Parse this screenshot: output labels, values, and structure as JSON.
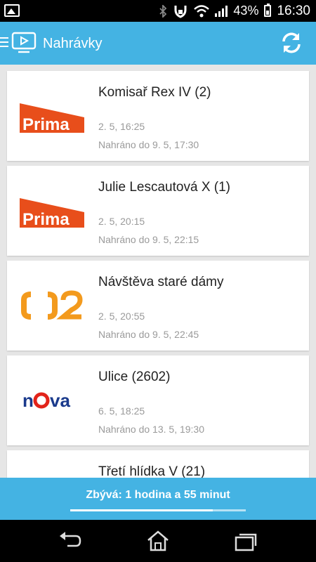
{
  "status_bar": {
    "notification_icon": "gallery-icon",
    "icons": [
      "bluetooth-icon",
      "lock-icon",
      "wifi-icon",
      "signal-icon"
    ],
    "battery_percent": "43%",
    "battery_level": 0.43,
    "time": "16:30"
  },
  "app_bar": {
    "title": "Nahrávky",
    "menu_icon": "hamburger-icon",
    "logo_icon": "tv-play-icon",
    "action_icon": "refresh-icon"
  },
  "recordings": [
    {
      "channel": "Prima",
      "title": "Komisař Rex IV (2)",
      "time": "2. 5, 16:25",
      "until": "Nahráno do 9. 5, 17:30"
    },
    {
      "channel": "Prima",
      "title": "Julie Lescautová X (1)",
      "time": "2. 5, 20:15",
      "until": "Nahráno do 9. 5, 22:15"
    },
    {
      "channel": "ČT2",
      "title": "Návštěva staré dámy",
      "time": "2. 5, 20:55",
      "until": "Nahráno do 9. 5, 22:45"
    },
    {
      "channel": "Nova",
      "title": "Ulice (2602)",
      "time": "6. 5, 18:25",
      "until": "Nahráno do 13. 5, 19:30"
    },
    {
      "channel": "",
      "title": "Třetí hlídka V (21)",
      "time": "",
      "until": ""
    }
  ],
  "remaining": {
    "text": "Zbývá: 1 hodina a 55 minut",
    "progress": 0.81
  },
  "colors": {
    "accent": "#44b3e3",
    "prima": "#e84e1b",
    "ct2": "#f39a1d",
    "nova_blue": "#1a3a8c",
    "nova_red": "#e2231a"
  },
  "nav": {
    "back_icon": "back-icon",
    "home_icon": "home-icon",
    "recents_icon": "recents-icon"
  }
}
